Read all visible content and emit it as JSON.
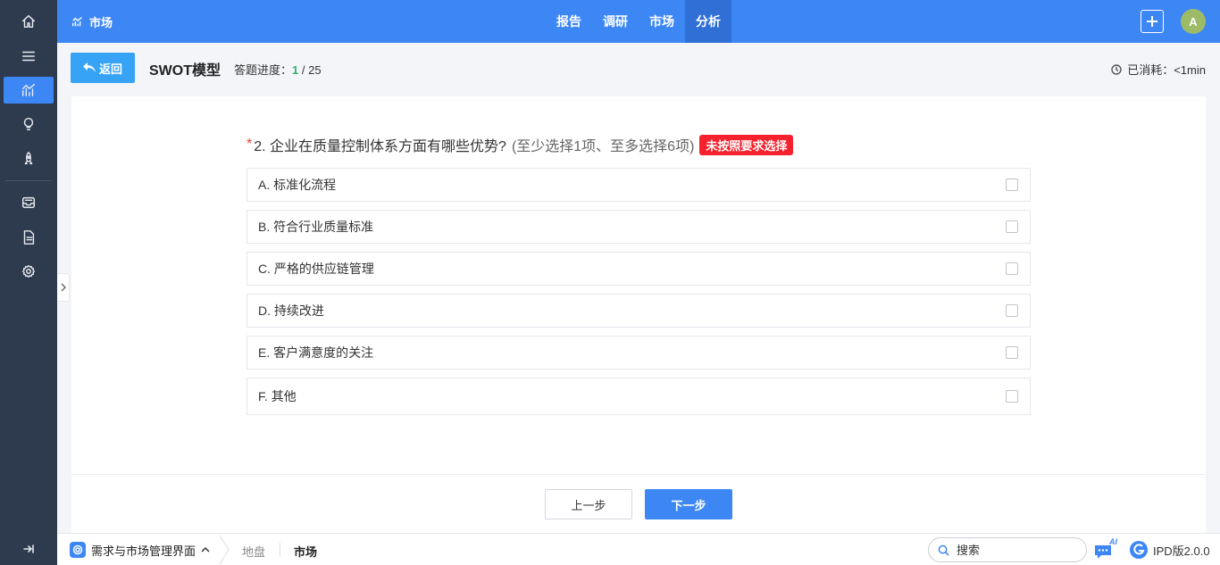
{
  "topbar": {
    "brand_label": "市场",
    "nav": [
      "报告",
      "调研",
      "市场",
      "分析"
    ],
    "active_nav": 3,
    "avatar_letter": "A"
  },
  "subheader": {
    "back_label": "返回",
    "title": "SWOT模型",
    "progress_label": "答题进度：",
    "progress_current": "1",
    "progress_total": " / 25",
    "elapsed_label": "已消耗：<1min"
  },
  "question": {
    "required_mark": "*",
    "text": "2. 企业在质量控制体系方面有哪些优势?",
    "hint": "(至少选择1项、至多选择6项)",
    "warning": "未按照要求选择",
    "options": [
      "A. 标准化流程",
      "B. 符合行业质量标准",
      "C. 严格的供应链管理",
      "D. 持续改进",
      "E. 客户满意度的关注",
      "F. 其他"
    ]
  },
  "actions": {
    "prev_label": "上一步",
    "next_label": "下一步"
  },
  "bottombar": {
    "workspace_label": "需求与市场管理界面",
    "crumb_1": "地盘",
    "crumb_2": "市场",
    "search_placeholder": "搜索",
    "ai_label": "AI",
    "version_label": "IPD版2.0.0"
  },
  "colors": {
    "primary": "#3d87f5",
    "sidebar": "#2e3a4d",
    "warning": "#f5222d",
    "progress_current": "#2db36d"
  }
}
